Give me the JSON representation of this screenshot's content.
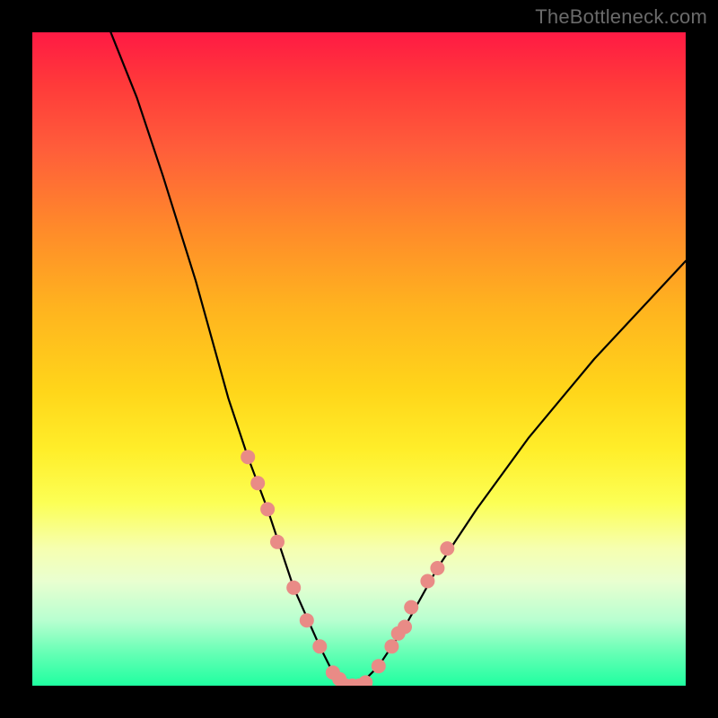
{
  "watermark": "TheBottleneck.com",
  "chart_data": {
    "type": "line",
    "title": "",
    "xlabel": "",
    "ylabel": "",
    "xlim": [
      0,
      100
    ],
    "ylim": [
      0,
      100
    ],
    "grid": false,
    "legend_position": "none",
    "annotation": "Background is colored by value: top (100) is red, middle (~50) is yellow, bottom (0) is green.",
    "series": [
      {
        "name": "bottleneck-curve",
        "x_left_branch": [
          12,
          16,
          20,
          25,
          30,
          33,
          36,
          40,
          44,
          46,
          48
        ],
        "y_left_branch": [
          100,
          90,
          78,
          62,
          44,
          35,
          27,
          15,
          6,
          2,
          0
        ],
        "x_right_branch": [
          48,
          50,
          53,
          57,
          62,
          68,
          76,
          86,
          100
        ],
        "y_right_branch": [
          0,
          0,
          3,
          9,
          18,
          27,
          38,
          50,
          65
        ],
        "note": "Single black V-shaped curve descending from top-left to a flat minimum near x≈48–50 then rising toward the right edge; no axis ticks or numeric labels are rendered in the image."
      },
      {
        "name": "highlight-dots",
        "x": [
          33,
          34.5,
          36,
          37.5,
          40,
          42,
          44,
          46,
          47,
          48,
          49,
          50,
          51,
          53,
          55,
          56,
          57,
          58,
          60.5,
          62,
          63.5
        ],
        "y": [
          35,
          31,
          27,
          22,
          15,
          10,
          6,
          2,
          1,
          0,
          0,
          0,
          0.5,
          3,
          6,
          8,
          9,
          12,
          16,
          18,
          21
        ],
        "marker_color": "#e98b86",
        "marker_radius_px": 8
      }
    ]
  }
}
